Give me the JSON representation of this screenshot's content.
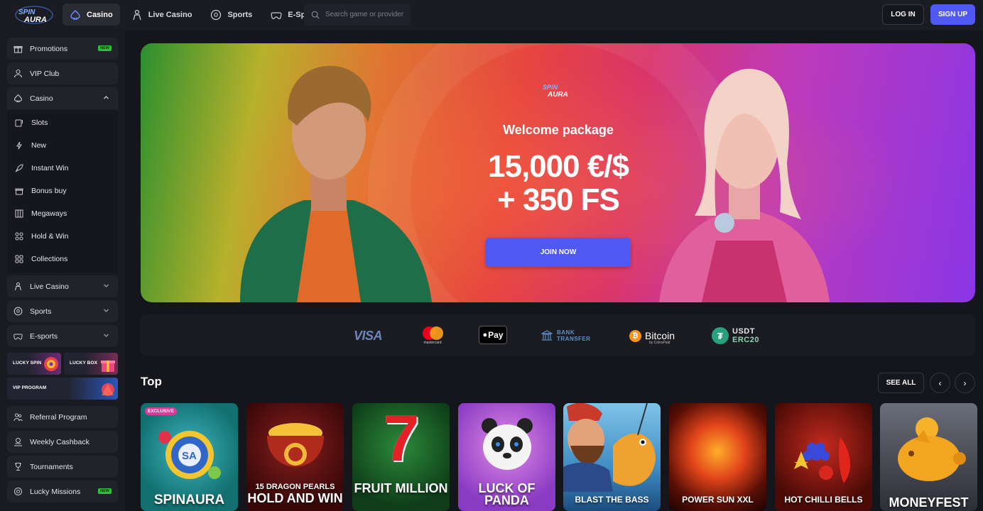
{
  "brand": {
    "name": "Spin Aura",
    "accent": "#4f58f0",
    "new_badge": "#2fbf3a"
  },
  "topnav": {
    "items": [
      {
        "label": "Casino",
        "icon": "spade-icon",
        "active": true
      },
      {
        "label": "Live Casino",
        "icon": "dealer-icon",
        "active": false
      },
      {
        "label": "Sports",
        "icon": "ball-icon",
        "active": false
      },
      {
        "label": "E-Sports",
        "icon": "gamepad-icon",
        "active": false
      }
    ],
    "search_placeholder": "Search game or provider",
    "login": "LOG IN",
    "signup": "SIGN UP"
  },
  "sidebar": {
    "promotions": {
      "label": "Promotions",
      "badge": "NEW"
    },
    "vip_club": "VIP Club",
    "casino": "Casino",
    "casino_sub": [
      "Slots",
      "New",
      "Instant Win",
      "Bonus buy",
      "Megaways",
      "Hold & Win",
      "Collections"
    ],
    "live_casino": "Live Casino",
    "sports": "Sports",
    "esports": "E-sports",
    "tiles": {
      "lucky_spin": "LUCKY SPIN",
      "lucky_box": "LUCKY BOX",
      "vip_program": "VIP PROGRAM"
    },
    "referral": "Referral Program",
    "weekly_cashback": "Weekly Cashback",
    "tournaments": "Tournaments",
    "lucky_missions": {
      "label": "Lucky Missions",
      "badge": "NEW"
    }
  },
  "hero": {
    "subtitle": "Welcome package",
    "title_line1": "15,000 €/$",
    "title_line2": "+ 350 FS",
    "cta": "JOIN NOW"
  },
  "payments": {
    "visa": "VISA",
    "mastercard": "mastercard",
    "apple_pay": "Pay",
    "bank_line1": "BANK",
    "bank_line2": "TRANSFER",
    "bitcoin": "Bitcoin",
    "bitcoin_sub": "by CoinsPaid",
    "usdt_line1": "USDT",
    "usdt_line2": "ERC20"
  },
  "top_section": {
    "title": "Top",
    "see_all": "SEE ALL",
    "prev": "‹",
    "next": "›",
    "games": [
      {
        "title": "SPINAURA",
        "badge": "EXCLUSIVE"
      },
      {
        "title_small": "15 DRAGON PEARLS",
        "title": "HOLD AND WIN"
      },
      {
        "title": "FRUIT MILLION"
      },
      {
        "title": "LUCK OF PANDA"
      },
      {
        "title": "BLAST THE BASS"
      },
      {
        "title": "POWER SUN XXL"
      },
      {
        "title": "HOT CHILLI BELLS"
      },
      {
        "title": "MONEYFEST"
      }
    ]
  }
}
